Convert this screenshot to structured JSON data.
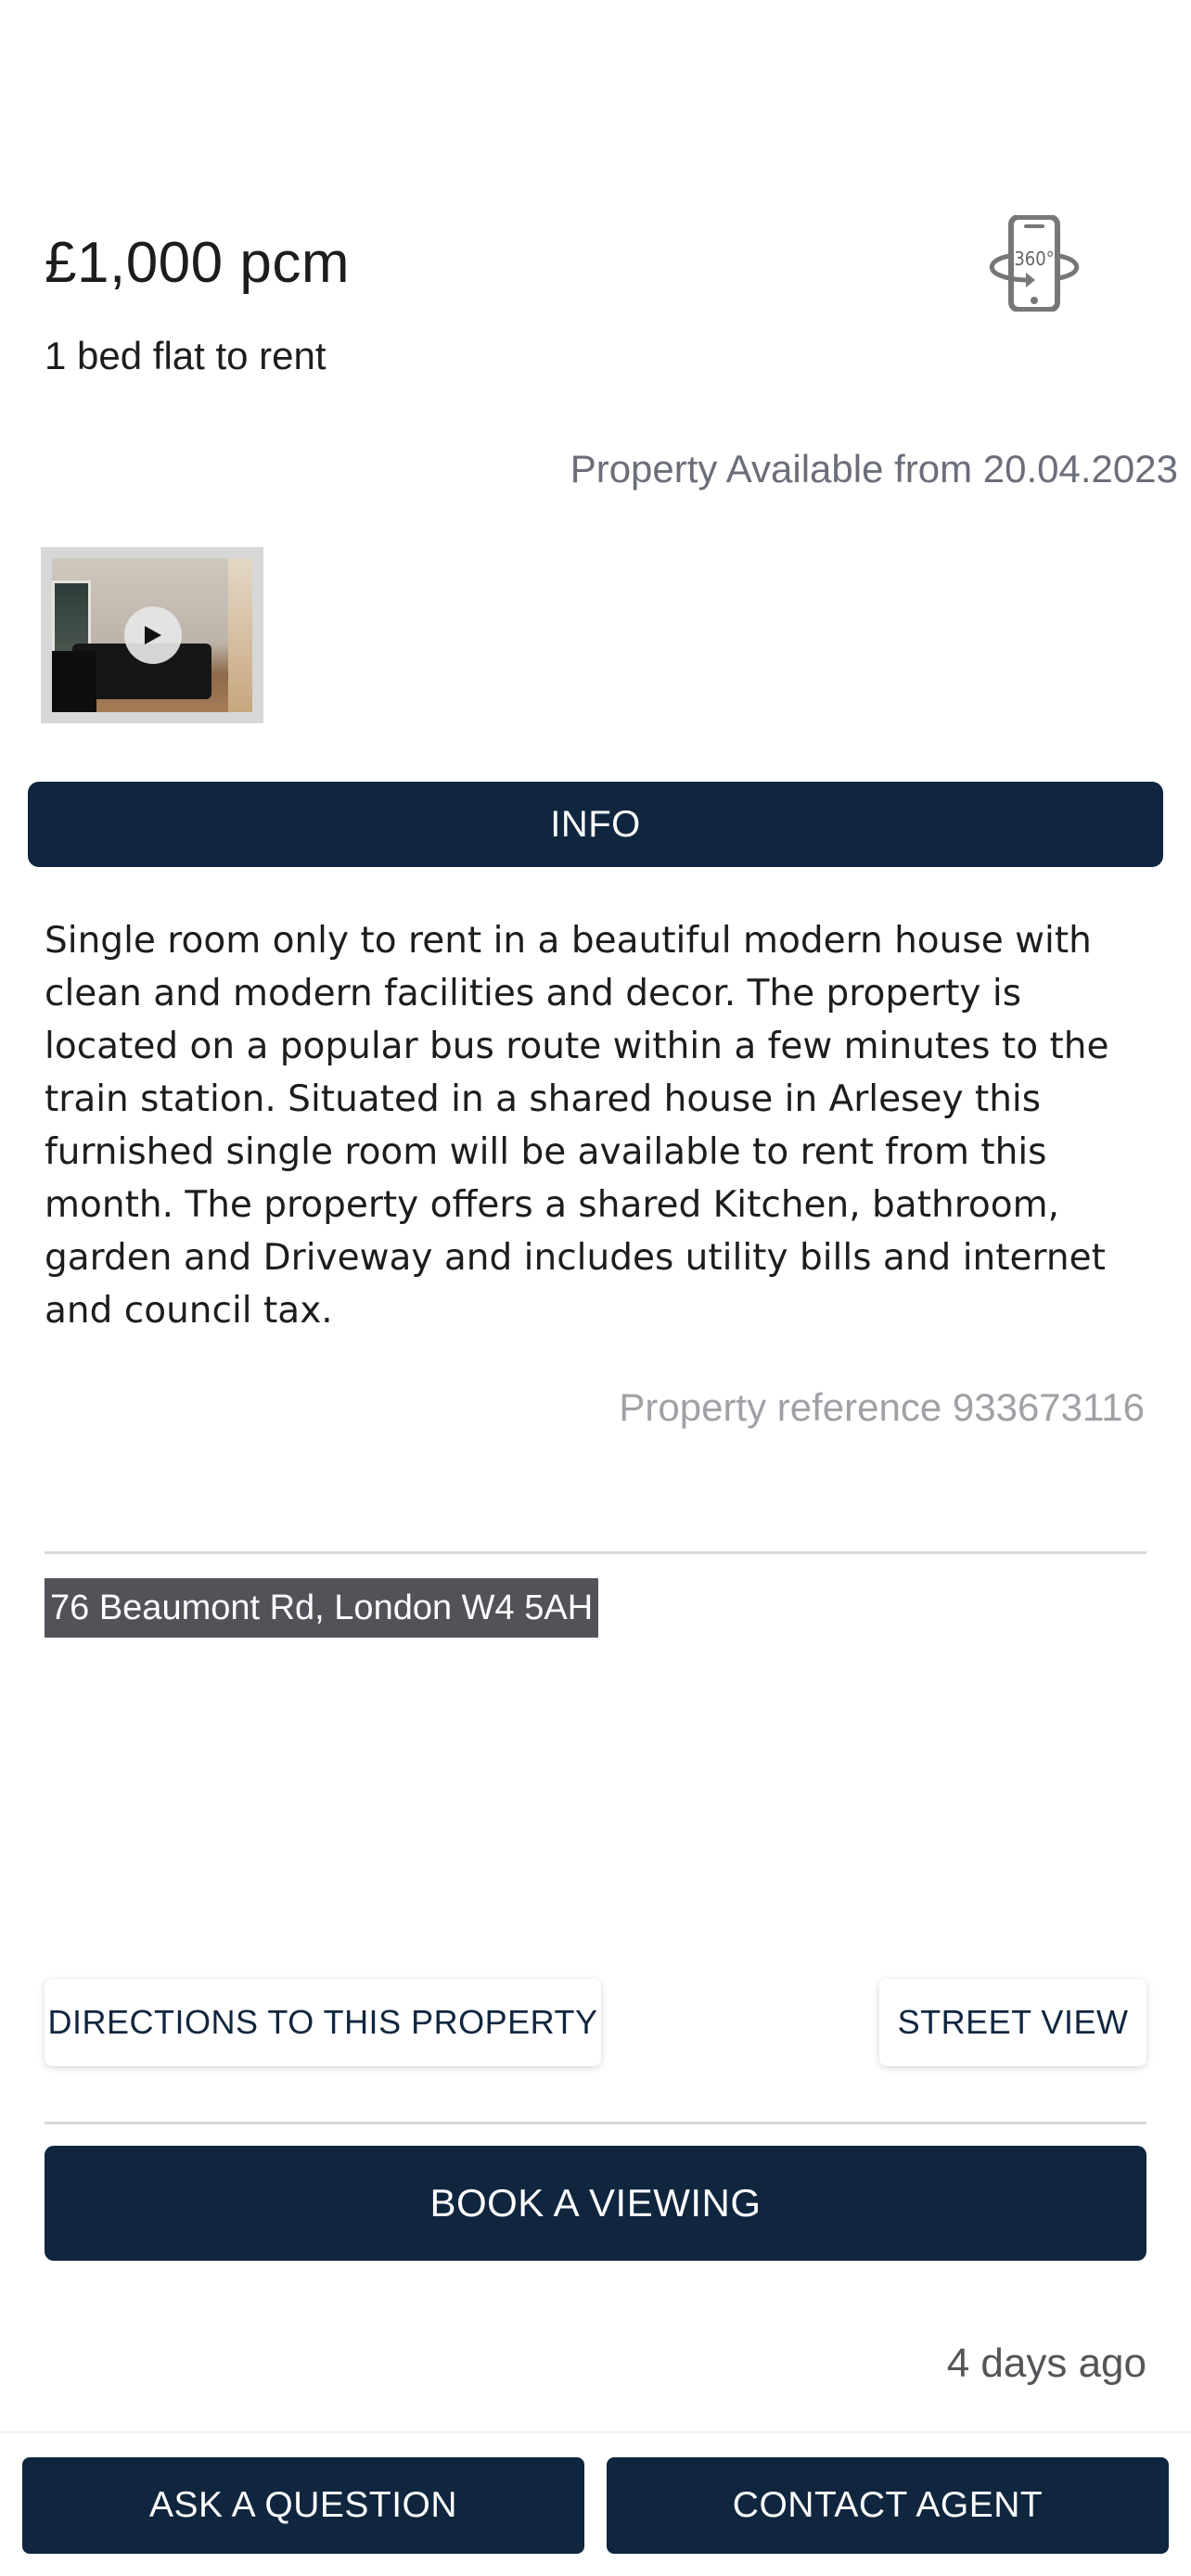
{
  "listing": {
    "price": "£1,000 pcm",
    "subtitle": "1 bed flat to rent",
    "availability": "Property Available from 20.04.2023",
    "virtual_tour_icon": "360-phone-icon",
    "video_thumbnail_icon": "play-icon",
    "info_label": "INFO",
    "description": "Single room only to rent in a beautiful modern house with clean and modern facilities and decor. The property is located on a popular bus route within a few minutes to the train station. Situated in a shared house in Arlesey this furnished single room will be available to rent from this month. The property offers a shared Kitchen, bathroom, garden and Driveway and includes utility bills and internet and council tax.",
    "reference": "Property reference 933673116",
    "address": "76 Beaumont Rd, London W4 5AH",
    "posted": "4 days ago"
  },
  "actions": {
    "directions_label": "DIRECTIONS TO THIS PROPERTY",
    "street_view_label": "STREET VIEW",
    "book_viewing_label": "BOOK A VIEWING",
    "ask_question_label": "ASK A QUESTION",
    "contact_agent_label": "CONTACT AGENT"
  },
  "colors": {
    "primary": "#10263f",
    "muted_text": "#6b6e7a",
    "address_bg": "#525258"
  }
}
